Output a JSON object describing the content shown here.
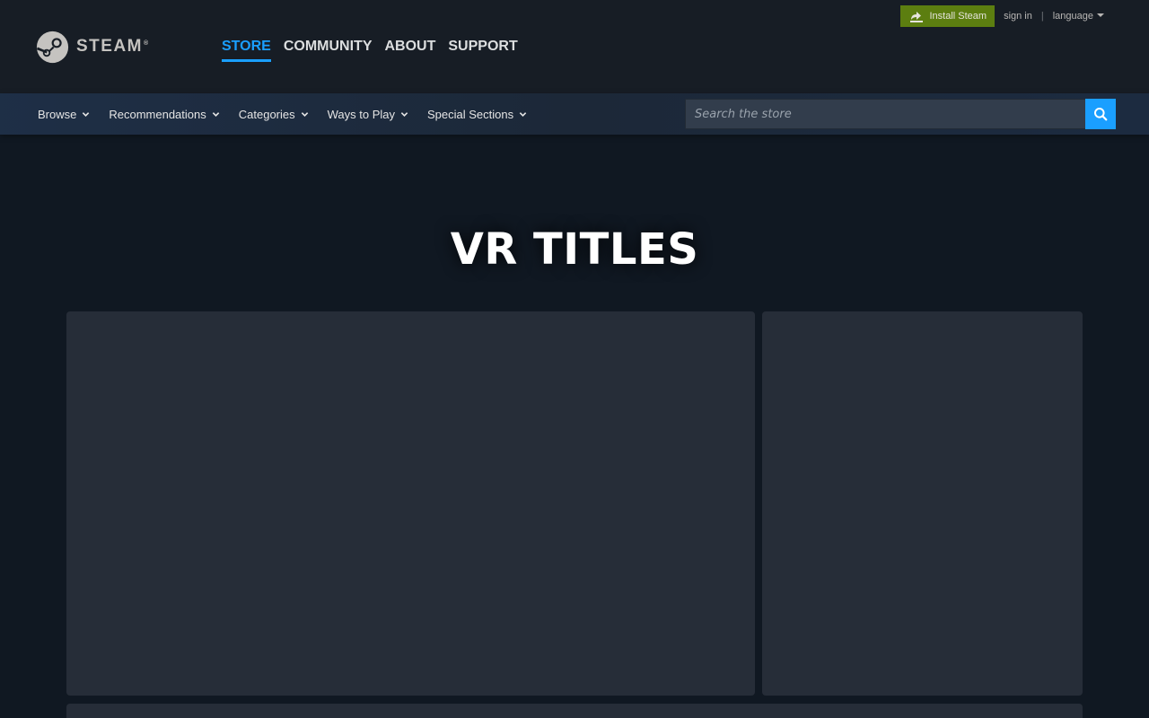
{
  "header": {
    "logo_word": "STEAM",
    "logo_tm": "®",
    "nav": [
      {
        "label": "STORE",
        "active": true
      },
      {
        "label": "COMMUNITY",
        "active": false
      },
      {
        "label": "ABOUT",
        "active": false
      },
      {
        "label": "SUPPORT",
        "active": false
      }
    ],
    "install_label": "Install Steam",
    "sign_in_label": "sign in",
    "separator": "|",
    "language_label": "language"
  },
  "store_nav": {
    "items": [
      {
        "label": "Browse"
      },
      {
        "label": "Recommendations"
      },
      {
        "label": "Categories"
      },
      {
        "label": "Ways to Play"
      },
      {
        "label": "Special Sections"
      }
    ],
    "search_placeholder": "Search the store"
  },
  "page": {
    "title": "VR TITLES"
  },
  "colors": {
    "accent": "#1a9fff",
    "install_green": "#5c7e10",
    "header_bg": "#171d25",
    "page_bg": "#101822",
    "panel_bg": "#262d38"
  },
  "icons": {
    "logo": "steam-logo-icon",
    "install": "download-icon",
    "dropdown": "chevron-down-icon",
    "search": "search-icon"
  }
}
